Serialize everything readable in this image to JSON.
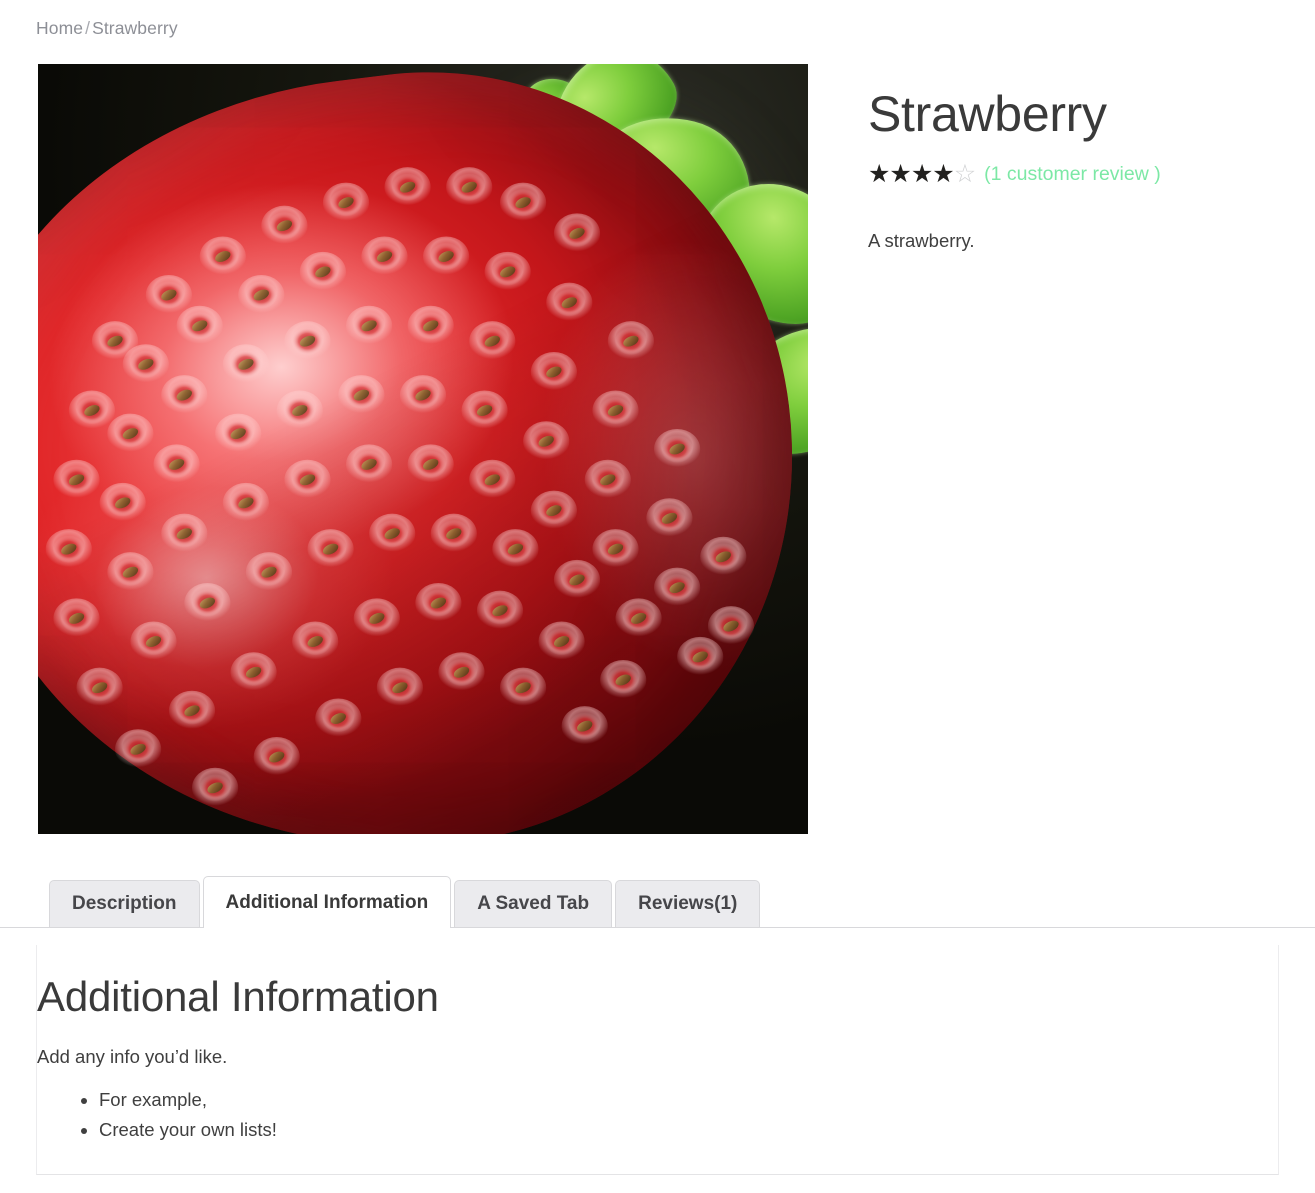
{
  "breadcrumb": {
    "home_label": "Home",
    "separator": "/",
    "current_label": "Strawberry"
  },
  "product": {
    "title": "Strawberry",
    "image_alt": "strawberry-photo",
    "rating_value": 4,
    "rating_max": 5,
    "star_full_glyph": "★",
    "star_empty_glyph": "☆",
    "review_link_label": "(1 customer review )",
    "review_link_color": "#7ce8a5",
    "short_description": "A strawberry."
  },
  "tabs": [
    {
      "label": "Description",
      "active": false
    },
    {
      "label": "Additional Information",
      "active": true
    },
    {
      "label": "A Saved Tab",
      "active": false
    },
    {
      "label": "Reviews(1)",
      "active": false
    }
  ],
  "panel": {
    "heading": "Additional Information",
    "intro": "Add any info you’d like.",
    "list_items": [
      "For example,",
      "Create your own lists!"
    ]
  }
}
